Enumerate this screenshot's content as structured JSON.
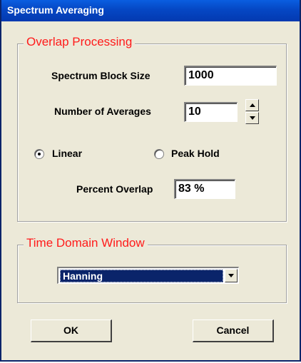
{
  "window": {
    "title": "Spectrum Averaging"
  },
  "overlap_group": {
    "legend": "Overlap Processing",
    "block_size_label": "Spectrum Block Size",
    "block_size_value": "1000",
    "averages_label": "Number of Averages",
    "averages_value": "10",
    "linear_label": "Linear",
    "linear_selected": true,
    "peak_hold_label": "Peak Hold",
    "peak_hold_selected": false,
    "percent_overlap_label": "Percent Overlap",
    "percent_overlap_value": "83 %"
  },
  "window_group": {
    "legend": "Time Domain Window",
    "selected_value": "Hanning"
  },
  "buttons": {
    "ok": "OK",
    "cancel": "Cancel"
  },
  "colors": {
    "titlebar": "#0547c4",
    "legend_text": "#ff1a1a",
    "dialog_bg": "#ece9d8",
    "selection": "#0a246a"
  },
  "icons": {
    "spin_up": "triangle-up-icon",
    "spin_down": "triangle-down-icon",
    "dropdown": "triangle-down-icon"
  }
}
